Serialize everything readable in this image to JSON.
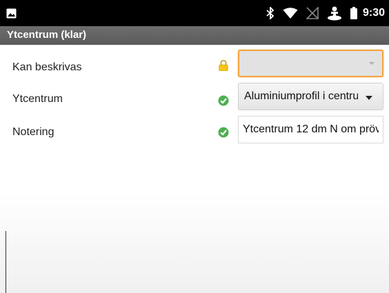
{
  "statusbar": {
    "left_icon": "image-notification-icon",
    "right_icons": [
      "bluetooth-icon",
      "wifi-icon",
      "no-sim-icon",
      "location-person-icon",
      "battery-icon"
    ],
    "time": "9:30"
  },
  "actionbar": {
    "title": "Ytcentrum (klar)"
  },
  "form": {
    "rows": [
      {
        "label": "Kan beskrivas",
        "status_icon": "lock-icon",
        "field_type": "spinner",
        "value": ""
      },
      {
        "label": "Ytcentrum",
        "status_icon": "check-icon",
        "field_type": "spinner",
        "value": "Aluminiumprofil i centrum"
      },
      {
        "label": "Notering",
        "status_icon": "check-icon",
        "field_type": "text",
        "value": "Ytcentrum 12 dm N om pröv"
      }
    ]
  },
  "colors": {
    "statusbar_bg": "#000000",
    "actionbar_bg": "#5f5f5f",
    "focus_border": "#f3a43e",
    "check_green": "#4caf50",
    "lock_yellow": "#f5c518"
  }
}
